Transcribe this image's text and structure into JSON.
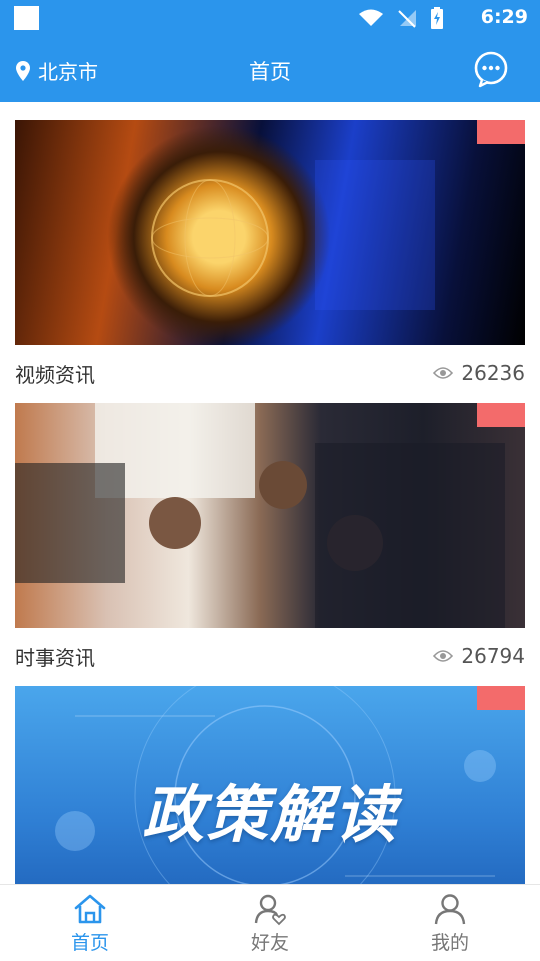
{
  "status": {
    "time": "6:29"
  },
  "header": {
    "location": "北京市",
    "title": "首页"
  },
  "feed": [
    {
      "title": "视频资讯",
      "views": "26236"
    },
    {
      "title": "时事资讯",
      "views": "26794"
    },
    {
      "title": "政策解读",
      "views": ""
    }
  ],
  "bottom_nav": [
    {
      "label": "首页",
      "active": true
    },
    {
      "label": "好友",
      "active": false
    },
    {
      "label": "我的",
      "active": false
    }
  ],
  "colors": {
    "accent": "#2b95ec",
    "ribbon": "#f36b6b",
    "inactive": "#777777"
  }
}
